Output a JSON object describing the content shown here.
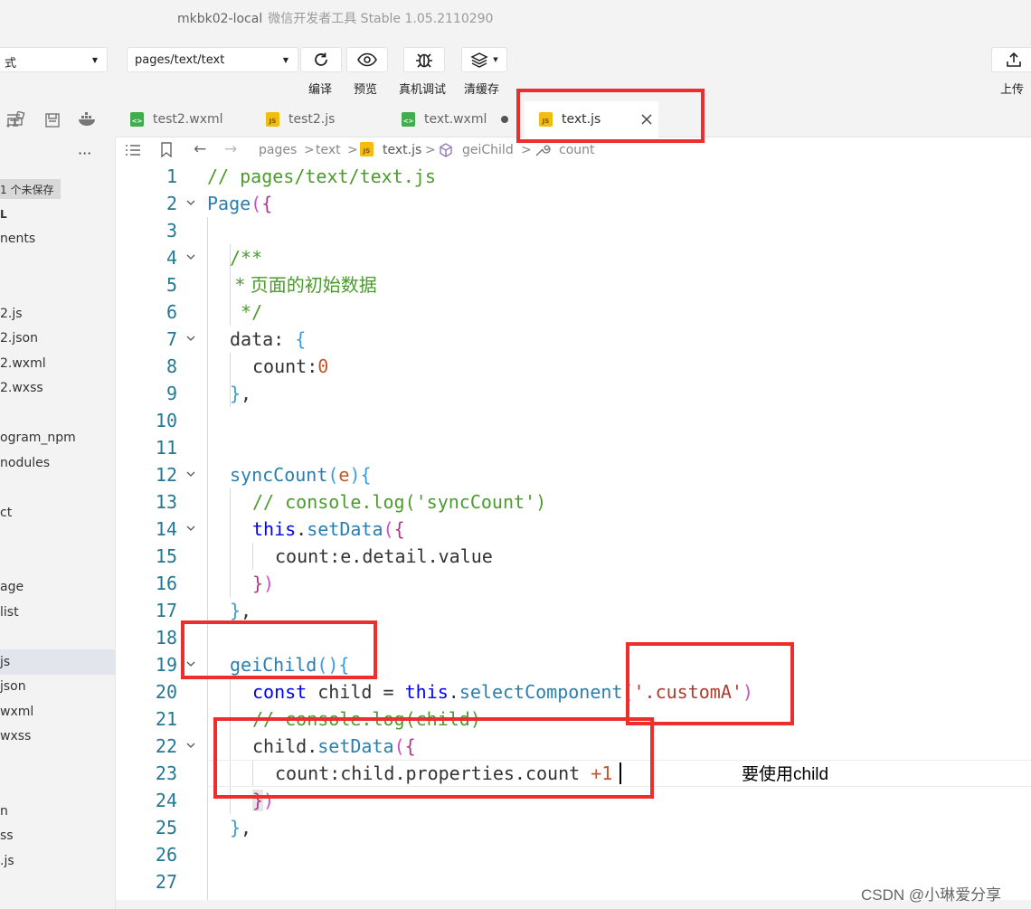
{
  "window": {
    "title": "mkbk02-local",
    "app": "微信开发者工具 Stable 1.05.2110290"
  },
  "toolbar": {
    "mode_select": "式",
    "page_select": "pages/text/text",
    "compile_label": "编译",
    "preview_label": "预览",
    "remote_debug_label": "真机调试",
    "clear_cache_label": "清缓存",
    "upload_label": "上传"
  },
  "tabs": [
    {
      "label": "test2.wxml",
      "type": "wxml"
    },
    {
      "label": "test2.js",
      "type": "js"
    },
    {
      "label": "text.wxml",
      "type": "wxml",
      "modified": true
    },
    {
      "label": "text.js",
      "type": "js",
      "active": true
    }
  ],
  "sidebar": {
    "more": "···",
    "unsaved_badge": "1 个未保存",
    "items": [
      "L",
      "nents",
      "2.js",
      "2.json",
      "2.wxml",
      "2.wxss",
      "ogram_npm",
      "nodules",
      "ct",
      "age",
      "list",
      "js",
      "json",
      "wxml",
      "wxss",
      "n",
      "ss",
      ".js"
    ]
  },
  "breadcrumb": {
    "parts": [
      "pages",
      "text",
      "text.js",
      "geiChild",
      "count"
    ],
    "sep": ">"
  },
  "editor": {
    "line_numbers": [
      "1",
      "2",
      "3",
      "4",
      "5",
      "6",
      "7",
      "8",
      "9",
      "10",
      "11",
      "12",
      "13",
      "14",
      "15",
      "16",
      "17",
      "18",
      "19",
      "20",
      "21",
      "22",
      "23",
      "24",
      "25",
      "26",
      "27"
    ],
    "comment_title": "// pages/text/text.js",
    "page_kw": "Page",
    "doc_open": "/**",
    "doc_text": " * 页面的初始数据",
    "doc_close": " */",
    "data_kw": "data",
    "count": "count",
    "zero": "0",
    "sync_fn": "syncCount",
    "param_e": "e",
    "sync_comment": "// console.log('syncCount')",
    "this_kw": "this",
    "set_data": "setData",
    "detail_value": "e.detail.value",
    "geichild_fn": "geiChild",
    "const_kw": "const",
    "child": "child",
    "select_component": "selectComponent",
    "selector_str": "'.customA'",
    "child_comment": "// console.log(child)",
    "properties_expr": "child.properties.count",
    "plus_one": "+1"
  },
  "annotation": "要使用child",
  "watermark": "CSDN @小琳爱分享",
  "colors": {
    "red_box": "#ee2d2d",
    "comment": "#4b9b2d",
    "keyword": "#0000ff",
    "line_number": "#237893"
  }
}
